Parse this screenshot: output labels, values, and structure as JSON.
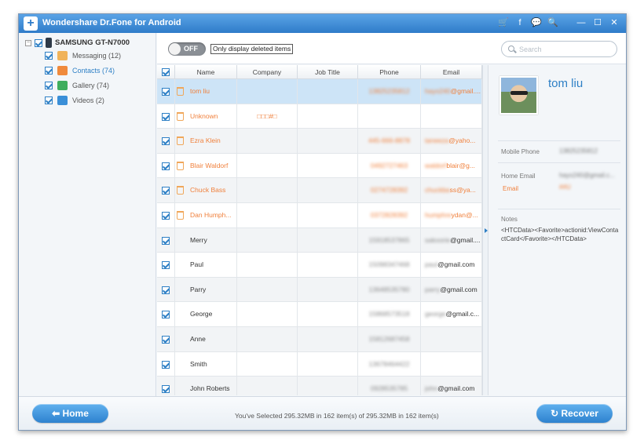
{
  "app": {
    "title": "Wondershare Dr.Fone for Android",
    "logo_glyph": "+"
  },
  "titlebar_icons": [
    "cart-icon",
    "facebook-icon",
    "feedback-icon",
    "register-icon",
    "minimize-icon",
    "maximize-icon",
    "close-icon"
  ],
  "titlebar_glyphs": {
    "cart": "🛒",
    "facebook": "f",
    "feedback": "💬",
    "register": "🔍",
    "minimize": "—",
    "maximize": "☐",
    "close": "✕"
  },
  "sidebar": {
    "device": "SAMSUNG GT-N7000",
    "items": [
      {
        "label": "Messaging (12)",
        "icon": "messaging-icon",
        "color": "#f0b35a"
      },
      {
        "label": "Contacts (74)",
        "icon": "contacts-icon",
        "color": "#f08a3c",
        "active": true
      },
      {
        "label": "Gallery (74)",
        "icon": "gallery-icon",
        "color": "#3fae5e"
      },
      {
        "label": "Videos (2)",
        "icon": "videos-icon",
        "color": "#3a8fd8"
      }
    ]
  },
  "toolbar": {
    "toggle_label": "OFF",
    "filter_label": "Only display deleted items",
    "search_placeholder": "Search"
  },
  "table": {
    "columns": [
      "Name",
      "Company",
      "Job Title",
      "Phone",
      "Email"
    ],
    "rows": [
      {
        "name": "tom liu",
        "company": "",
        "job": "",
        "phone": "13825235812",
        "email_hidden": "hayo240",
        "email_visible": "@gmail....",
        "deleted": true,
        "selected": true
      },
      {
        "name": "Unknown",
        "company": "□□□#□",
        "job": "",
        "phone": "",
        "email_hidden": "",
        "email_visible": "",
        "deleted": true
      },
      {
        "name": "Ezra Klein",
        "company": "",
        "job": "",
        "phone": "445-666-8878",
        "email_hidden": "taneeza",
        "email_visible": "@yaho...",
        "deleted": true
      },
      {
        "name": "Blair Waldorf",
        "company": "",
        "job": "",
        "phone": "0492727463",
        "email_hidden": "waldorf",
        "email_visible": "blair@g...",
        "deleted": true
      },
      {
        "name": "Chuck Bass",
        "company": "",
        "job": "",
        "phone": "0274728392",
        "email_hidden": "chuckba",
        "email_visible": "ss@ya...",
        "deleted": true
      },
      {
        "name": "Dan Humph...",
        "company": "",
        "job": "",
        "phone": "0372828392",
        "email_hidden": "humphre",
        "email_visible": "ydan@...",
        "deleted": true
      },
      {
        "name": "Merry",
        "company": "",
        "job": "",
        "phone": "15918537865",
        "email_hidden": "sakoorie",
        "email_visible": "@gmail....",
        "deleted": false
      },
      {
        "name": "Paul",
        "company": "",
        "job": "",
        "phone": "15098347468",
        "email_hidden": "paul",
        "email_visible": "@gmail.com",
        "deleted": false
      },
      {
        "name": "Parry",
        "company": "",
        "job": "",
        "phone": "13648535780",
        "email_hidden": "parry",
        "email_visible": "@gmail.com",
        "deleted": false
      },
      {
        "name": "George",
        "company": "",
        "job": "",
        "phone": "15868573518",
        "email_hidden": "george",
        "email_visible": "@gmail.c...",
        "deleted": false
      },
      {
        "name": "Anne",
        "company": "",
        "job": "",
        "phone": "15812687458",
        "email_hidden": "",
        "email_visible": "",
        "deleted": false
      },
      {
        "name": "Smith",
        "company": "",
        "job": "",
        "phone": "13678464422",
        "email_hidden": "",
        "email_visible": "",
        "deleted": false
      },
      {
        "name": "John  Roberts",
        "company": "",
        "job": "",
        "phone": "0928535785",
        "email_hidden": "john",
        "email_visible": "@gmail.com",
        "deleted": false
      }
    ]
  },
  "detail": {
    "name": "tom liu",
    "mobile_phone_label": "Mobile Phone",
    "mobile_phone_value": "13825235812",
    "home_email_label": "Home Email",
    "home_email_value": "hayo240@gmail.c...",
    "email_label": "Email",
    "email_value": "##U",
    "notes_label": "Notes",
    "notes_value": "<HTCData><Favorite>actionid:ViewContactCard</Favorite></HTCData>"
  },
  "footer": {
    "home_label": "Home",
    "home_glyph": "⬅",
    "recover_label": "Recover",
    "recover_glyph": "↻",
    "status": "You've Selected 295.32MB in 162 item(s) of 295.32MB in 162 item(s)"
  },
  "colors": {
    "accent": "#2d7fc5",
    "deleted": "#f0803c",
    "selected_row": "#cde4f7"
  }
}
